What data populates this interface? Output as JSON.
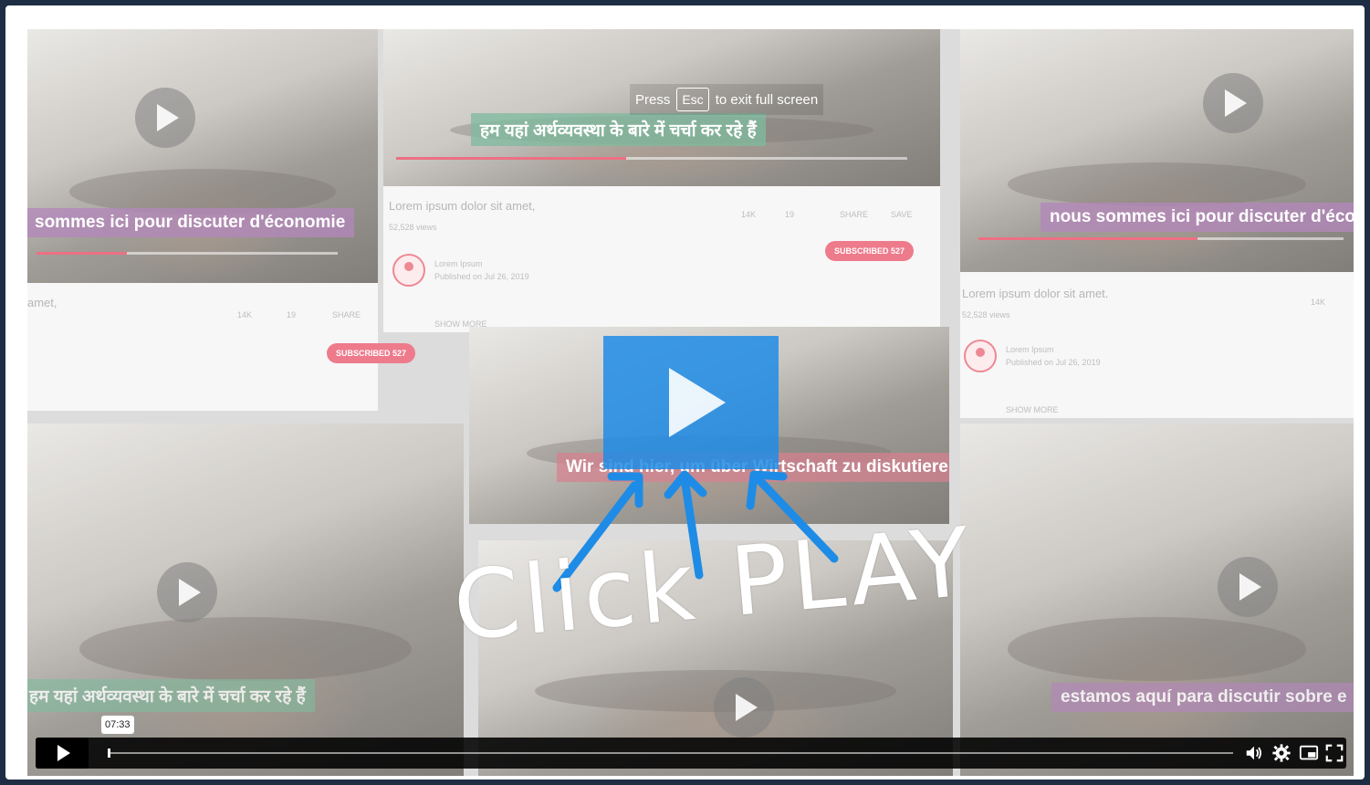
{
  "player": {
    "esc_hint": {
      "prefix": "Press",
      "key": "Esc",
      "suffix": "to exit full screen"
    },
    "cta_text": "Click PLAY",
    "controls": {
      "time_tooltip": "07:33",
      "progress": 0.0,
      "icons": [
        "play-icon",
        "volume-icon",
        "settings-icon",
        "picture-in-picture-icon",
        "fullscreen-icon"
      ]
    }
  },
  "collage": {
    "subtitles": {
      "top_left": "sommes ici pour discuter d'économie",
      "top_center": "हम यहां अर्थव्यवस्था के बारे में चर्चा कर रहे हैं",
      "top_right": "nous sommes ici pour discuter d'éco",
      "center": "Wir sind hier, um über Wirtschaft zu diskutieren",
      "bottom_left": "हम यहां अर्थव्यवस्था के बारे में चर्चा कर रहे हैं",
      "bottom_right": "estamos aquí para discutir sobre e"
    },
    "video_titles": {
      "center": "Lorem ipsum dolor sit amet,",
      "right": "Lorem ipsum dolor sit amet.",
      "left": "amet,"
    },
    "views": "52,528 views",
    "channel_name": "Lorem Ipsum",
    "published": "Published on Jul 26, 2019",
    "show_more": "SHOW MORE",
    "subscribed_label": "SUBSCRIBED 527",
    "likes": "14K",
    "dislikes": "19",
    "share": "SHARE",
    "save": "SAVE"
  },
  "colors": {
    "page_bg": "#1d2d44",
    "accent_blue": "#1e8ce6",
    "subscribe_red": "#e84860"
  }
}
